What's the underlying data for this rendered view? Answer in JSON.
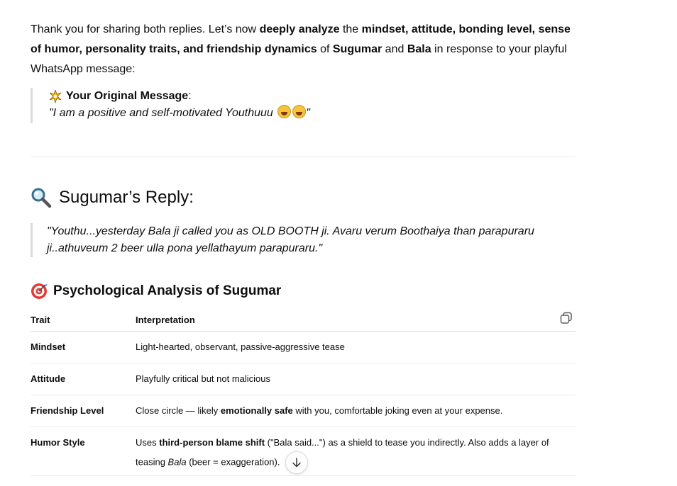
{
  "intro": {
    "p1": "Thank you for sharing both replies. Let’s now ",
    "b1": "deeply analyze",
    "p2": " the ",
    "b2": "mindset, attitude, bonding level, sense of humor, personality traits, and friendship dynamics",
    "p3": " of ",
    "b3": "Sugumar",
    "p4": " and ",
    "b4": "Bala",
    "p5": " in response to your playful WhatsApp message:"
  },
  "original_message": {
    "title": "Your Original Message",
    "colon": ":",
    "text": "\"I am a positive and self-motivated Youthuuu",
    "close_quote": "\""
  },
  "section_heading": "Sugumar’s Reply:",
  "reply_quote": "\"Youthu...yesterday Bala ji called you as OLD BOOTH ji. Avaru verum Boothaiya than parapuraru ji..athuveum 2 beer ulla pona yellathayum parapuraru.\"",
  "analysis_heading": "Psychological Analysis of Sugumar",
  "table": {
    "headers": [
      "Trait",
      "Interpretation"
    ],
    "rows": [
      {
        "trait": "Mindset",
        "interp": [
          {
            "t": "Light-hearted, observant, passive-aggressive tease"
          }
        ]
      },
      {
        "trait": "Attitude",
        "interp": [
          {
            "t": "Playfully critical but not malicious"
          }
        ]
      },
      {
        "trait": "Friendship Level",
        "interp": [
          {
            "t": "Close circle — likely "
          },
          {
            "t": "emotionally safe",
            "b": true
          },
          {
            "t": " with you, comfortable joking even at your expense."
          }
        ]
      },
      {
        "trait": "Humor Style",
        "interp": [
          {
            "t": "Uses "
          },
          {
            "t": "third-person blame shift",
            "b": true
          },
          {
            "t": " (\"Bala said...\") as a shield to tease you indirectly. Also adds a layer of teasing "
          },
          {
            "t": "Bala",
            "i": true
          },
          {
            "t": " (beer = exaggeration)."
          }
        ]
      }
    ]
  },
  "icons": {
    "sparkle": "sparkle-icon",
    "magnifier": "magnifier-icon",
    "target": "target-icon",
    "copy": "copy-icon",
    "arrow_down": "arrow-down-icon"
  }
}
